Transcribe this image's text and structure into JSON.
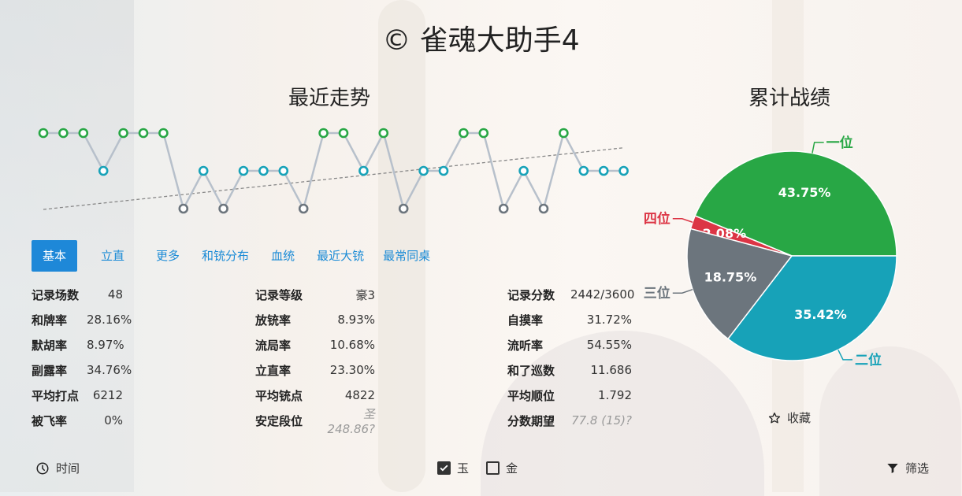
{
  "app_title": "© 雀魂大助手4",
  "trend": {
    "title": "最近走势",
    "ranks": [
      1,
      1,
      1,
      2,
      1,
      1,
      1,
      3,
      2,
      3,
      2,
      2,
      2,
      3,
      1,
      1,
      2,
      1,
      3,
      2,
      2,
      1,
      1,
      3,
      2,
      3,
      1,
      2,
      2,
      2
    ],
    "colors": {
      "1": "#28a745",
      "2": "#17a2b8",
      "3": "#6c757d",
      "4": "#dc3545",
      "line": "#b7c0cb",
      "avg": "#888888"
    }
  },
  "tabs": [
    {
      "label": "基本",
      "active": true
    },
    {
      "label": "立直",
      "active": false
    },
    {
      "label": "更多",
      "active": false
    },
    {
      "label": "和铳分布",
      "active": false
    },
    {
      "label": "血统",
      "active": false
    },
    {
      "label": "最近大铳",
      "active": false
    },
    {
      "label": "最常同桌",
      "active": false
    }
  ],
  "stats": {
    "col1": [
      {
        "label": "记录场数",
        "value": "48"
      },
      {
        "label": "和牌率",
        "value": "28.16%"
      },
      {
        "label": "默胡率",
        "value": "8.97%"
      },
      {
        "label": "副露率",
        "value": "34.76%"
      },
      {
        "label": "平均打点",
        "value": "6212"
      },
      {
        "label": "被飞率",
        "value": "0%"
      }
    ],
    "col2": [
      {
        "label": "记录等级",
        "value": "豪3"
      },
      {
        "label": "放铳率",
        "value": "8.93%"
      },
      {
        "label": "流局率",
        "value": "10.68%"
      },
      {
        "label": "立直率",
        "value": "23.30%"
      },
      {
        "label": "平均铳点",
        "value": "4822"
      },
      {
        "label": "安定段位",
        "value": "圣248.86?",
        "muted": true
      }
    ],
    "col3": [
      {
        "label": "记录分数",
        "value": "2442/3600"
      },
      {
        "label": "自摸率",
        "value": "31.72%"
      },
      {
        "label": "流听率",
        "value": "54.55%"
      },
      {
        "label": "和了巡数",
        "value": "11.686"
      },
      {
        "label": "平均顺位",
        "value": "1.792"
      },
      {
        "label": "分数期望",
        "value": "77.8 (15)?",
        "muted": true
      }
    ]
  },
  "cumulative": {
    "title": "累计战绩",
    "chart_data": {
      "type": "pie",
      "categories": [
        "一位",
        "四位",
        "三位",
        "二位"
      ],
      "values": [
        43.75,
        2.08,
        18.75,
        35.42
      ],
      "labels": [
        "43.75%",
        "2.08%",
        "18.75%",
        "35.42%"
      ],
      "colors": [
        "#28a745",
        "#dc3545",
        "#6c757d",
        "#17a2b8"
      ]
    }
  },
  "favorite_label": "收藏",
  "bottom": {
    "time_label": "时间",
    "jade_label": "玉",
    "gold_label": "金",
    "jade_checked": true,
    "gold_checked": false,
    "filter_label": "筛选"
  }
}
